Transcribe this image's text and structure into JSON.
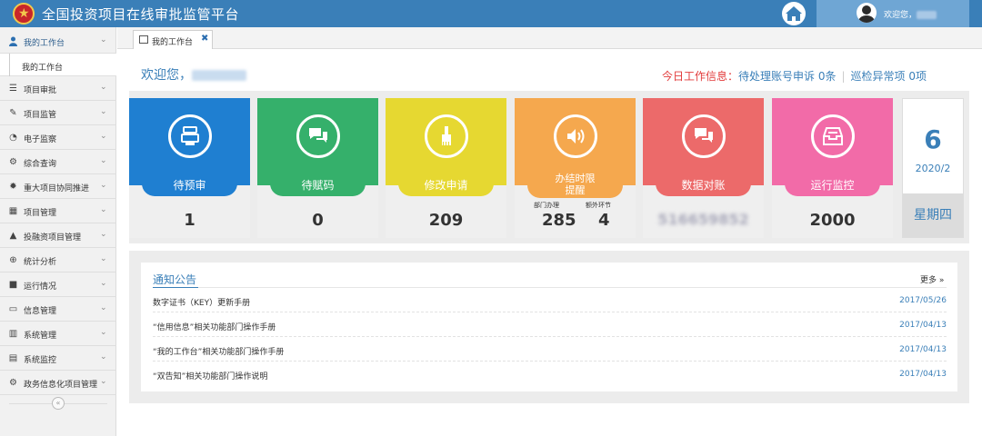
{
  "header": {
    "title": "全国投资项目在线审批监管平台",
    "welcome_prefix": "欢迎您，"
  },
  "sidebar": {
    "items": [
      {
        "label": "我的工作台",
        "icon": "user-icon",
        "active": true
      },
      {
        "label": "项目审批",
        "icon": "list-icon"
      },
      {
        "label": "项目监管",
        "icon": "edit-icon"
      },
      {
        "label": "电子监察",
        "icon": "dashboard-icon"
      },
      {
        "label": "综合查询",
        "icon": "cogs-icon"
      },
      {
        "label": "重大项目协同推进",
        "icon": "gear-icon"
      },
      {
        "label": "项目管理",
        "icon": "windows-icon"
      },
      {
        "label": "投融资项目管理",
        "icon": "bell-icon"
      },
      {
        "label": "统计分析",
        "icon": "search-icon"
      },
      {
        "label": "运行情况",
        "icon": "folder-icon"
      },
      {
        "label": "信息管理",
        "icon": "monitor-icon"
      },
      {
        "label": "系统管理",
        "icon": "chart-icon"
      },
      {
        "label": "系统监控",
        "icon": "calendar-icon"
      },
      {
        "label": "政务信息化项目管理",
        "icon": "cogs-icon"
      }
    ],
    "subitem": "我的工作台"
  },
  "tabs": [
    {
      "label": "我的工作台"
    }
  ],
  "main": {
    "welcome": "欢迎您，",
    "today_label": "今日工作信息：",
    "today_item1": "待处理账号申诉 0条",
    "today_item2": "巡检异常项 0项"
  },
  "cards": [
    {
      "label": "待预审",
      "value": "1",
      "color": "#1f7fd1"
    },
    {
      "label": "待赋码",
      "value": "0",
      "color": "#35b06b"
    },
    {
      "label": "修改申请",
      "value": "209",
      "color": "#e6d831"
    },
    {
      "label1": "办结时限",
      "label2": "提醒",
      "sub_label1": "部门办理",
      "sub_label2": "额外环节",
      "sub_value1": "285",
      "sub_value2": "4",
      "color": "#f5a84e"
    },
    {
      "label": "数据对账",
      "value": "516659852",
      "color": "#ec6a6a"
    },
    {
      "label": "运行监控",
      "value": "2000",
      "color": "#f26ba8"
    }
  ],
  "date": {
    "day": "6",
    "year_month": "2020/2",
    "weekday": "星期四"
  },
  "notice": {
    "title": "通知公告",
    "more": "更多 »",
    "rows": [
      {
        "title": "数字证书（KEY）更新手册",
        "date": "2017/05/26"
      },
      {
        "title": "“信用信息”相关功能部门操作手册",
        "date": "2017/04/13"
      },
      {
        "title": "“我的工作台”相关功能部门操作手册",
        "date": "2017/04/13"
      },
      {
        "title": "“双告知”相关功能部门操作说明",
        "date": "2017/04/13"
      }
    ]
  }
}
